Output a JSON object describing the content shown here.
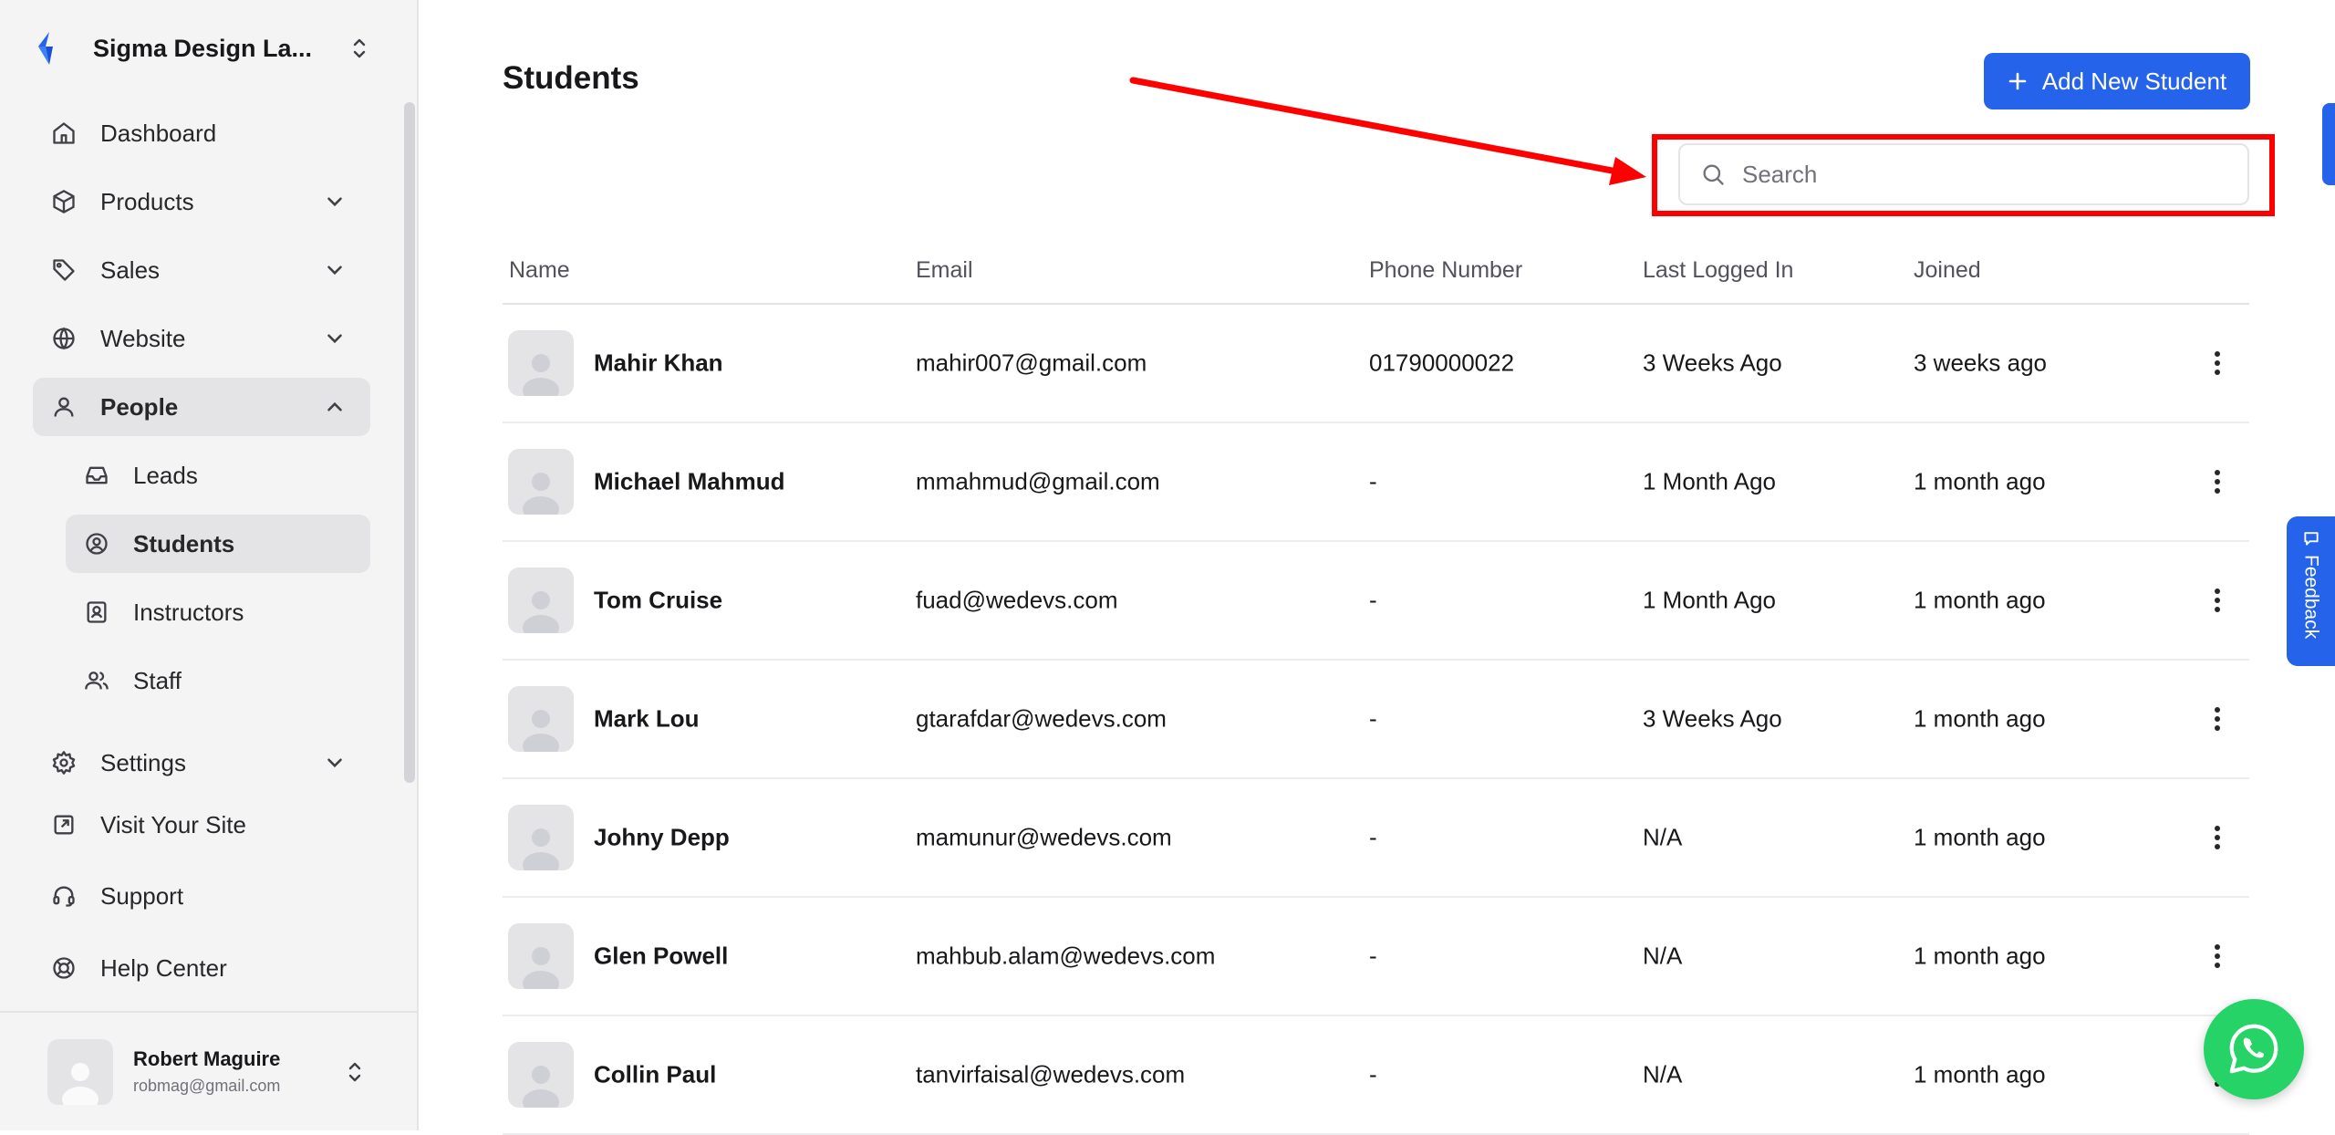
{
  "sidebar": {
    "brand_name": "Sigma Design La...",
    "items": {
      "dashboard": "Dashboard",
      "products": "Products",
      "sales": "Sales",
      "website": "Website",
      "people": "People",
      "leads": "Leads",
      "students": "Students",
      "instructors": "Instructors",
      "staff": "Staff",
      "settings": "Settings",
      "visit_site": "Visit Your Site",
      "support": "Support",
      "help_center": "Help Center"
    },
    "active_item": "Students",
    "user": {
      "name": "Robert Maguire",
      "email": "robmag@gmail.com"
    }
  },
  "main": {
    "title": "Students",
    "add_button_label": "Add New Student",
    "search_placeholder": "Search",
    "columns": [
      "Name",
      "Email",
      "Phone Number",
      "Last Logged In",
      "Joined"
    ],
    "rows": [
      {
        "name": "Mahir Khan",
        "email": "mahir007@gmail.com",
        "phone": "01790000022",
        "last_logged_in": "3 Weeks Ago",
        "joined": "3 weeks ago"
      },
      {
        "name": "Michael Mahmud",
        "email": "mmahmud@gmail.com",
        "phone": "-",
        "last_logged_in": "1 Month Ago",
        "joined": "1 month ago"
      },
      {
        "name": "Tom Cruise",
        "email": "fuad@wedevs.com",
        "phone": "-",
        "last_logged_in": "1 Month Ago",
        "joined": "1 month ago"
      },
      {
        "name": "Mark Lou",
        "email": "gtarafdar@wedevs.com",
        "phone": "-",
        "last_logged_in": "3 Weeks Ago",
        "joined": "1 month ago"
      },
      {
        "name": "Johny Depp",
        "email": "mamunur@wedevs.com",
        "phone": "-",
        "last_logged_in": "N/A",
        "joined": "1 month ago"
      },
      {
        "name": "Glen Powell",
        "email": "mahbub.alam@wedevs.com",
        "phone": "-",
        "last_logged_in": "N/A",
        "joined": "1 month ago"
      },
      {
        "name": "Collin Paul",
        "email": "tanvirfaisal@wedevs.com",
        "phone": "-",
        "last_logged_in": "N/A",
        "joined": "1 month ago"
      }
    ]
  },
  "feedback_label": "Feedback",
  "colors": {
    "accent": "#2563eb",
    "highlight": "#ff0000",
    "whatsapp": "#25d366"
  },
  "icons": [
    "brand-logo-icon",
    "home-icon",
    "box-icon",
    "tag-icon",
    "globe-icon",
    "user-icon",
    "inbox-icon",
    "user-circle-icon",
    "id-card-icon",
    "users-icon",
    "gear-icon",
    "external-link-icon",
    "headset-icon",
    "lifebuoy-icon",
    "search-icon",
    "plus-icon",
    "kebab-icon",
    "whatsapp-icon",
    "chat-icon"
  ]
}
